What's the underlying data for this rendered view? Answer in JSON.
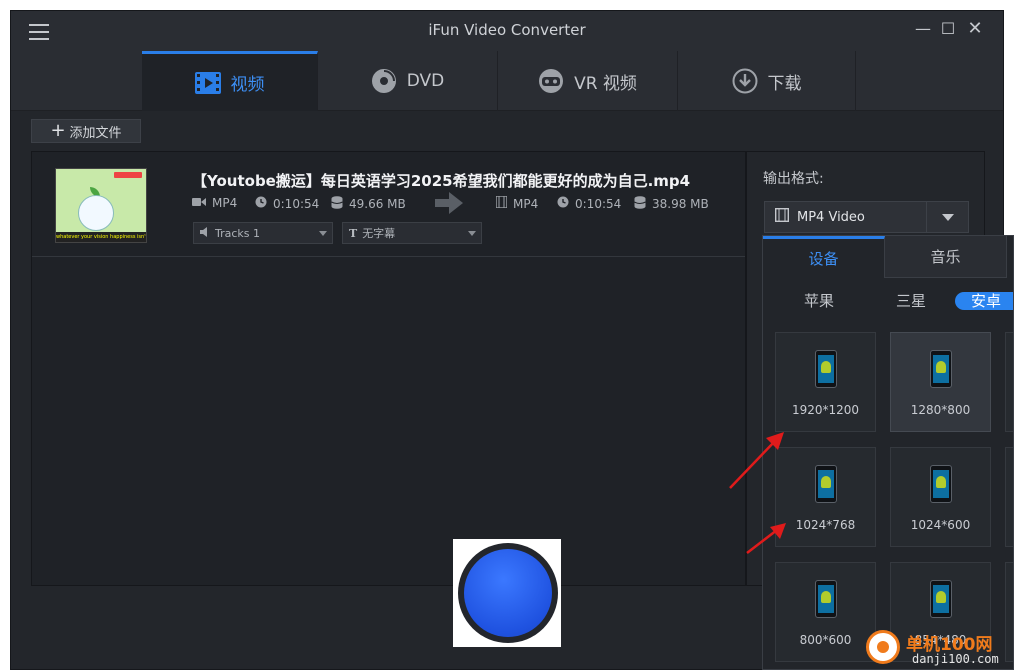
{
  "app": {
    "title": "iFun Video Converter"
  },
  "tabs": [
    {
      "label": "视频",
      "icon": "video-icon",
      "active": true
    },
    {
      "label": "DVD",
      "icon": "disc-icon",
      "active": false
    },
    {
      "label": "VR 视频",
      "icon": "vr-headset-icon",
      "active": false
    },
    {
      "label": "下载",
      "icon": "download-icon",
      "active": false
    }
  ],
  "toolbar": {
    "add_label": "添加文件"
  },
  "file": {
    "title": "【Youtobe搬运】每日英语学习2025希望我们都能更好的成为自己.mp4",
    "source": {
      "format": "MP4",
      "duration": "0:10:54",
      "size": "49.66 MB"
    },
    "target": {
      "format": "MP4",
      "duration": "0:10:54",
      "size": "38.98 MB"
    },
    "audio_track": "Tracks 1",
    "subtitle": "无字幕",
    "thumbnail_caption": "whatever your vision happiness isn't some distant goal"
  },
  "output": {
    "label": "输出格式:",
    "selected_format": "MP4 Video"
  },
  "popup": {
    "tabs": [
      {
        "label": "设备",
        "active": true
      },
      {
        "label": "音乐",
        "active": false
      }
    ],
    "brands": [
      {
        "label": "苹果",
        "active": false
      },
      {
        "label": "三星",
        "active": false
      },
      {
        "label": "安卓",
        "active": true
      }
    ],
    "resolutions": [
      "1920*1200",
      "1280*800",
      "1024*768",
      "1024*600",
      "800*600",
      "854*480"
    ]
  },
  "watermark": {
    "site": "单机100网",
    "domain": "danji100.com"
  },
  "colors": {
    "accent": "#2a7ee8",
    "record": "#2458e6",
    "background": "#2a2d33",
    "arrow": "#e01b1b"
  }
}
